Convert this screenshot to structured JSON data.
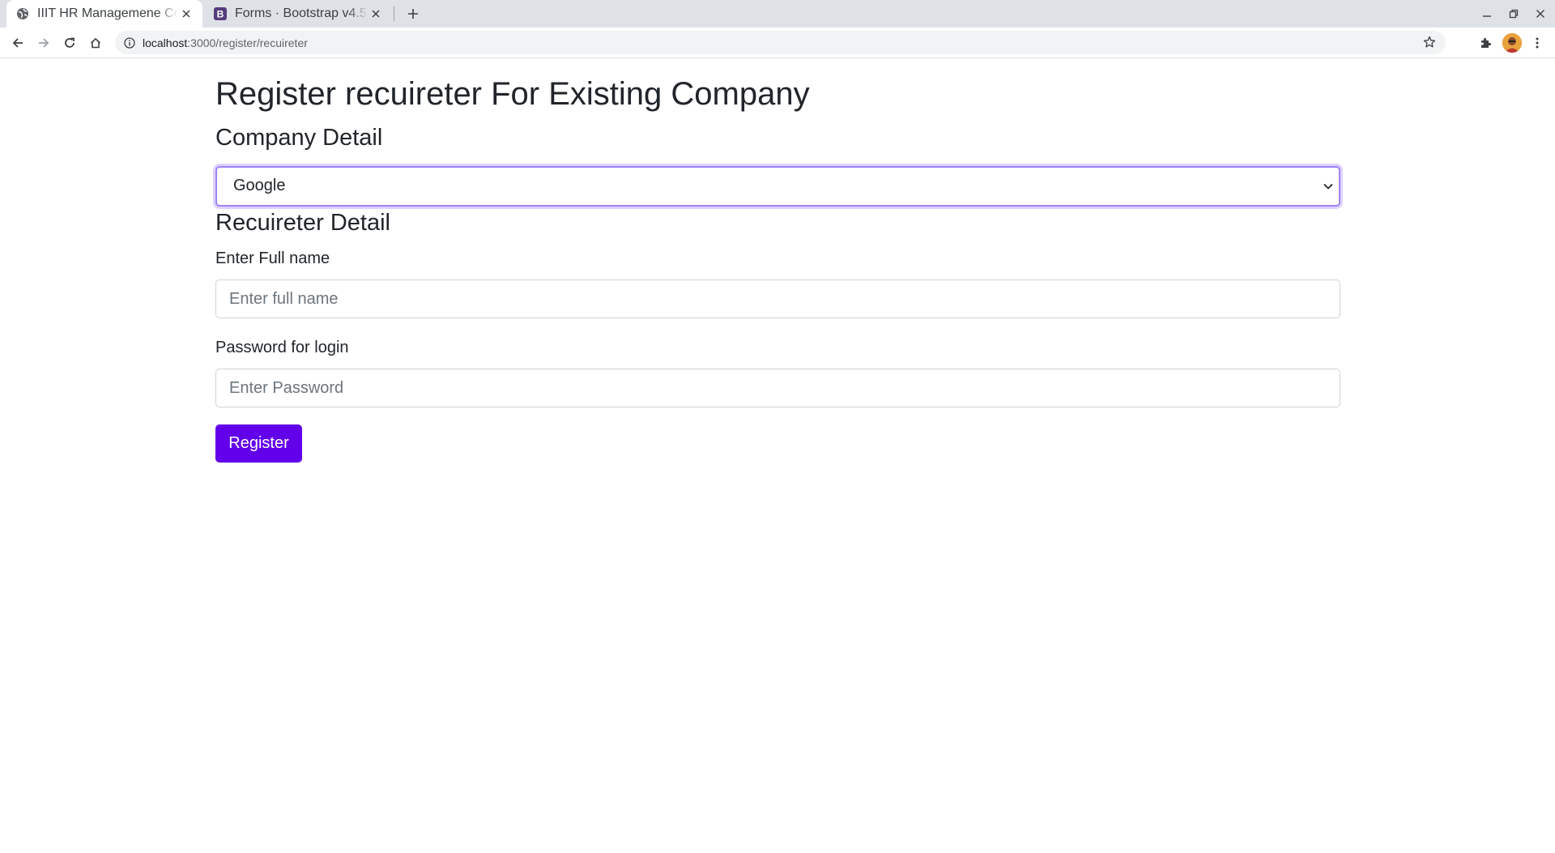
{
  "browser": {
    "tabs": [
      {
        "title": "IIIT HR Managemene Co",
        "active": true,
        "favicon": "globe-icon"
      },
      {
        "title": "Forms · Bootstrap v4.5",
        "active": false,
        "favicon": "bootstrap-icon",
        "favicon_letter": "B"
      }
    ],
    "url_host": "localhost",
    "url_path": ":3000/register/recuireter"
  },
  "page": {
    "title": "Register recuireter For Existing Company",
    "company_section": "Company Detail",
    "company_select_value": "Google",
    "recruiter_section": "Recuireter Detail",
    "name_label": "Enter Full name",
    "name_placeholder": "Enter full name",
    "password_label": "Password for login",
    "password_placeholder": "Enter Password",
    "register_label": "Register"
  },
  "colors": {
    "accent": "#6200ea",
    "focus_border": "#9e83f7",
    "bootstrap_brand": "#563d7c"
  }
}
